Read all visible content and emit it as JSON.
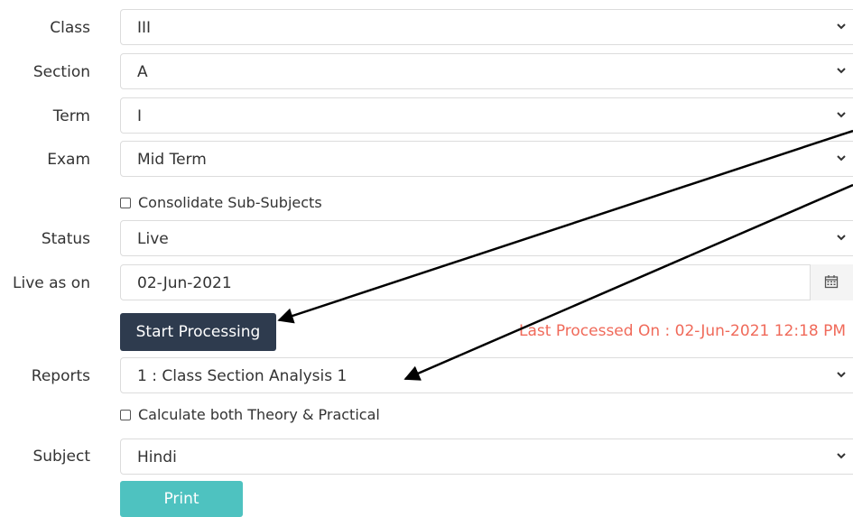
{
  "form": {
    "class_label": "Class",
    "class_value": "III",
    "section_label": "Section",
    "section_value": "A",
    "term_label": "Term",
    "term_value": "I",
    "exam_label": "Exam",
    "exam_value": "Mid Term",
    "consolidate_label": "Consolidate Sub-Subjects",
    "status_label": "Status",
    "status_value": "Live",
    "live_label": "Live as on",
    "live_value": "02-Jun-2021",
    "start_button": "Start Processing",
    "last_processed": "Last Processed On : 02-Jun-2021 12:18 PM",
    "reports_label": "Reports",
    "reports_value": "1 : Class Section Analysis 1",
    "calc_label": "Calculate both Theory & Practical",
    "subject_label": "Subject",
    "subject_value": "Hindi",
    "print_button": "Print"
  },
  "icons": {
    "dropdown": "chevron-down-icon",
    "calendar": "calendar-icon",
    "annotation": "arrow-annotation"
  },
  "colors": {
    "primary_button": "#2e3b4e",
    "print_button": "#4ec2c0",
    "processed_text": "#f06a5a"
  }
}
